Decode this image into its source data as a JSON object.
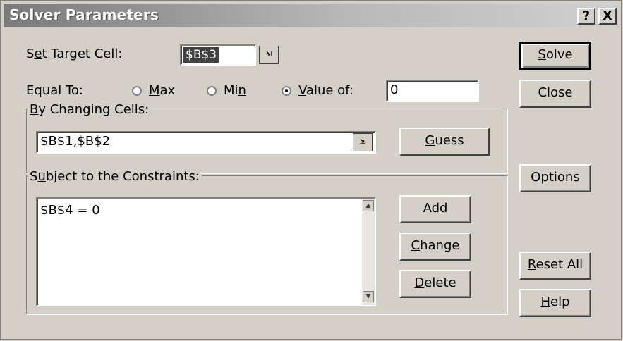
{
  "window": {
    "title": "Solver Parameters",
    "help_btn": "?",
    "close_btn": "X"
  },
  "target": {
    "label_pre": "S",
    "label_ul": "e",
    "label_post": "t Target Cell:",
    "value": "$B$3"
  },
  "equal_to": {
    "label": "Equal To:",
    "max_ul": "M",
    "max_post": "ax",
    "min_pre": "Mi",
    "min_ul": "n",
    "value_ul": "V",
    "value_post": "alue of:",
    "value_field": "0",
    "selected": "value"
  },
  "changing": {
    "group_ul": "B",
    "group_post": "y Changing Cells:",
    "value": "$B$1,$B$2",
    "guess_ul": "G",
    "guess_post": "uess"
  },
  "constraints": {
    "group_pre": "S",
    "group_ul": "u",
    "group_post": "bject to the Constraints:",
    "items": [
      "$B$4 = 0"
    ],
    "add_ul": "A",
    "add_post": "dd",
    "change_ul": "C",
    "change_post": "hange",
    "delete_ul": "D",
    "delete_post": "elete"
  },
  "side_buttons": {
    "solve_ul": "S",
    "solve_post": "olve",
    "close": "Close",
    "options_ul": "O",
    "options_post": "ptions",
    "reset_ul": "R",
    "reset_post": "eset All",
    "help_ul": "H",
    "help_post": "elp"
  },
  "icons": {
    "ref_collapse": "⇲",
    "scroll_up": "▲",
    "scroll_down": "▼"
  }
}
